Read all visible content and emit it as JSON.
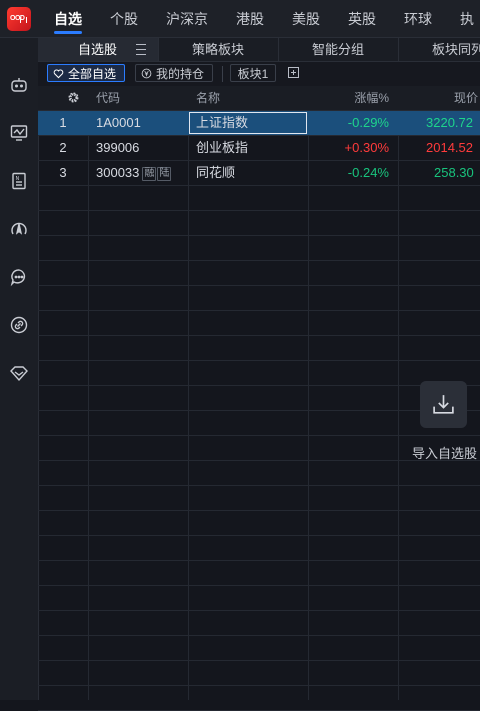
{
  "topnav": {
    "items": [
      {
        "label": "自选"
      },
      {
        "label": "个股"
      },
      {
        "label": "沪深京"
      },
      {
        "label": "港股"
      },
      {
        "label": "美股"
      },
      {
        "label": "英股"
      },
      {
        "label": "环球"
      },
      {
        "label": "执"
      }
    ],
    "active_index": 0
  },
  "sidebar": {
    "icons": [
      "robot-icon",
      "monitor-chart-icon",
      "news-icon",
      "compass-icon",
      "chat-icon",
      "link-icon",
      "diamond-icon"
    ]
  },
  "subtabs": {
    "items": [
      {
        "label": "自选股"
      },
      {
        "label": "策略板块"
      },
      {
        "label": "智能分组"
      },
      {
        "label": "板块同列"
      }
    ],
    "active_index": 0
  },
  "filters": {
    "all": "全部自选",
    "holdings": "我的持仓",
    "board": "板块1"
  },
  "table": {
    "headers": {
      "settings": "gear-icon",
      "code": "代码",
      "name": "名称",
      "change": "涨幅%",
      "price": "现价"
    },
    "rows": [
      {
        "idx": "1",
        "code": "1A0001",
        "name": "上证指数",
        "change": "-0.29%",
        "price": "3220.72",
        "direction": "down",
        "tags": []
      },
      {
        "idx": "2",
        "code": "399006",
        "name": "创业板指",
        "change": "+0.30%",
        "price": "2014.52",
        "direction": "up",
        "tags": []
      },
      {
        "idx": "3",
        "code": "300033",
        "name": "同花顺",
        "change": "-0.24%",
        "price": "258.30",
        "direction": "down",
        "tags": [
          "融",
          "陆"
        ]
      }
    ],
    "selected_index": 0
  },
  "import": {
    "label": "导入自选股",
    "icon": "download-tray-icon"
  },
  "colors": {
    "accent": "#2b7cff",
    "up": "#ff3b3b",
    "down": "#19c37d",
    "selected_row": "#1b4f7c",
    "brand": "#e8262e"
  }
}
